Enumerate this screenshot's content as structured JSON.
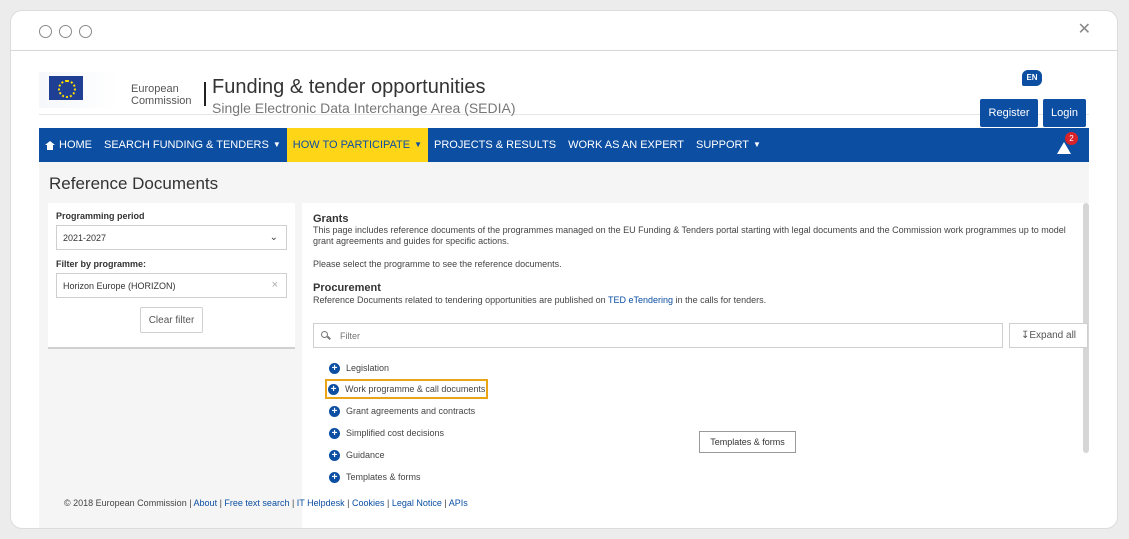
{
  "header": {
    "logo_line1": "European",
    "logo_line2": "Commission",
    "title": "Funding & tender opportunities",
    "subtitle": "Single Electronic Data Interchange Area (SEDIA)",
    "lang": "EN",
    "register_label": "Register",
    "login_label": "Login"
  },
  "nav": {
    "items": [
      {
        "label": "HOME"
      },
      {
        "label": "SEARCH FUNDING & TENDERS"
      },
      {
        "label": "HOW TO PARTICIPATE"
      },
      {
        "label": "PROJECTS & RESULTS"
      },
      {
        "label": "WORK AS AN EXPERT"
      },
      {
        "label": "SUPPORT"
      }
    ],
    "alert_count": "2"
  },
  "page": {
    "title": "Reference Documents"
  },
  "filters": {
    "period_label": "Programming period",
    "period_value": "2021-2027",
    "programme_label": "Filter by programme:",
    "programme_value": "Horizon Europe (HORIZON)",
    "clear_label": "Clear filter"
  },
  "content": {
    "grants_heading": "Grants",
    "grants_text": "This page includes reference documents of the programmes managed on the EU Funding & Tenders portal starting with legal documents and the Commission work programmes up to model grant agreements and guides for specific actions.",
    "select_prompt": "Please select the programme to see the reference documents.",
    "procurement_heading": "Procurement",
    "procurement_text_before": "Reference Documents related to tendering opportunities are published on",
    "procurement_link": "TED eTendering",
    "procurement_text_after": "in the calls for tenders.",
    "filter_placeholder": "Filter",
    "expand_all_label": "↧Expand all",
    "documents": [
      {
        "label": "Legislation"
      },
      {
        "label": "Work programme & call documents"
      },
      {
        "label": "Grant agreements and contracts"
      },
      {
        "label": "Simplified cost decisions"
      },
      {
        "label": "Guidance"
      },
      {
        "label": "Templates & forms"
      }
    ]
  },
  "tooltip": "Templates & forms",
  "footer": {
    "copyright": "© 2018 European Commission",
    "links": [
      "About",
      "Free text search",
      "IT Helpdesk",
      "Cookies",
      "Legal Notice",
      "APIs"
    ]
  }
}
